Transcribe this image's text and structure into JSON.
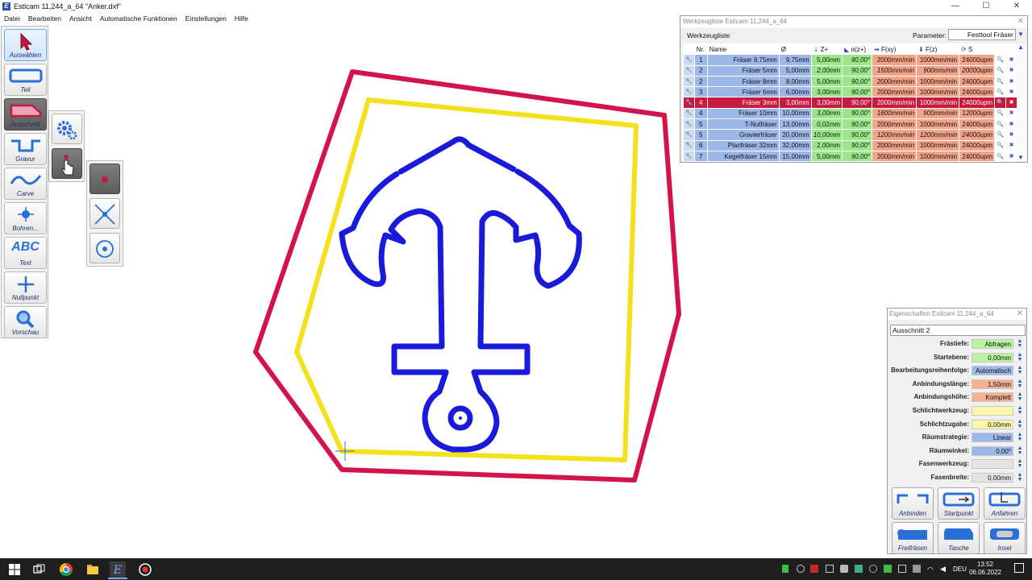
{
  "window": {
    "title": "Estlcam 11,244_a_64 \"Anker.dxf\"",
    "app_icon": "E",
    "minimize": "—",
    "maximize": "☐",
    "close": "✕"
  },
  "menu": [
    "Datei",
    "Bearbeiten",
    "Ansicht",
    "Automatische Funktionen",
    "Einstellungen",
    "Hilfe"
  ],
  "toolbar": [
    {
      "id": "auswahlen",
      "label": "Auswählen",
      "icon": "cursor-arrow-icon"
    },
    {
      "id": "teil",
      "label": "Teil",
      "icon": "part-outline-icon"
    },
    {
      "id": "ausschnitt",
      "label": "Ausschnitt",
      "icon": "cutout-icon"
    },
    {
      "id": "gravur",
      "label": "Gravur",
      "icon": "engrave-icon"
    },
    {
      "id": "carve",
      "label": "Carve",
      "icon": "carve-wave-icon"
    },
    {
      "id": "bohren",
      "label": "Bohren...",
      "icon": "drill-target-icon"
    },
    {
      "id": "text",
      "label": "Text",
      "glyph": "ABC",
      "icon": "text-abc-icon"
    },
    {
      "id": "nullpunkt",
      "label": "Nullpunkt",
      "icon": "zero-point-cross-icon"
    },
    {
      "id": "vorschau",
      "label": "Vorschau",
      "icon": "magnifier-icon"
    }
  ],
  "tool_window": {
    "title": "Werkzeugliste Estlcam 11,244_a_64",
    "close": "✕",
    "heading": "Werkzeugliste",
    "param_label": "Parameter:",
    "param_value": "Festtool Fräser",
    "columns": [
      "Nr.",
      "Name",
      "Ø",
      "Z+",
      "α(z+)",
      "F(xy)",
      "F(z)",
      "S"
    ],
    "rows": [
      {
        "nr": "1",
        "name": "Fräser 9,75mm",
        "d": "9,75mm",
        "z": "5,00mm",
        "az": "90,00°",
        "fxy": "2000mm/min",
        "fz": "1000mm/min",
        "s": "24000upm"
      },
      {
        "nr": "2",
        "name": "Fräser 5mm",
        "d": "5,00mm",
        "z": "2,00mm",
        "az": "90,00°",
        "fxy": "1500mm/min",
        "fz": "900mm/min",
        "s": "20000upm",
        "muted": true
      },
      {
        "nr": "2",
        "name": "Fräser 8mm",
        "d": "8,00mm",
        "z": "5,00mm",
        "az": "90,00°",
        "fxy": "2000mm/min",
        "fz": "1000mm/min",
        "s": "24000upm"
      },
      {
        "nr": "3",
        "name": "Fräser 6mm",
        "d": "6,00mm",
        "z": "3,00mm",
        "az": "90,00°",
        "fxy": "2000mm/min",
        "fz": "1000mm/min",
        "s": "24000upm"
      },
      {
        "nr": "4",
        "name": "Fräser 3mm",
        "d": "3,00mm",
        "z": "3,00mm",
        "az": "90,00°",
        "fxy": "2000mm/min",
        "fz": "1000mm/min",
        "s": "24000upm",
        "selected": true
      },
      {
        "nr": "4",
        "name": "Fräser 10mm",
        "d": "10,00mm",
        "z": "3,00mm",
        "az": "90,00°",
        "fxy": "1800mm/min",
        "fz": "900mm/min",
        "s": "12000upm",
        "muted": true
      },
      {
        "nr": "5",
        "name": "T-Nutfräser",
        "d": "13,00mm",
        "z": "0,02mm",
        "az": "90,00°",
        "fxy": "2000mm/min",
        "fz": "1000mm/min",
        "s": "24000upm"
      },
      {
        "nr": "5",
        "name": "Gravierfräser",
        "d": "20,00mm",
        "z": "10,00mm",
        "az": "90,00°",
        "fxy": "1200mm/min",
        "fz": "1200mm/min",
        "s": "24000upm",
        "muted": true
      },
      {
        "nr": "6",
        "name": "Planfräser 32mm",
        "d": "32,00mm",
        "z": "2,00mm",
        "az": "90,00°",
        "fxy": "2000mm/min",
        "fz": "1000mm/min",
        "s": "24000upm"
      },
      {
        "nr": "7",
        "name": "Kegelfräser 15mm",
        "d": "15,00mm",
        "z": "5,00mm",
        "az": "90,00°",
        "fxy": "2000mm/min",
        "fz": "1000mm/min",
        "s": "24000upm"
      }
    ]
  },
  "props_window": {
    "title": "Eigenschaften Estlcam 11,244_a_64",
    "close": "✕",
    "object_name": "Ausschnitt 2",
    "fields": [
      {
        "label": "Frästiefe:",
        "value": "Abfragen",
        "color": "#b9f59e"
      },
      {
        "label": "Startebene:",
        "value": "0,00mm",
        "color": "#b9f59e"
      },
      {
        "label": "Bearbeitungsreihenfolge:",
        "value": "Automatisch",
        "color": "#9db7e8"
      },
      {
        "label": "Anbindungslänge:",
        "value": "1,50mm",
        "color": "#f4b08f"
      },
      {
        "label": "Anbindungshöhe:",
        "value": "Komplett",
        "color": "#f4b08f"
      },
      {
        "label": "Schlichtwerkzeug:",
        "value": "",
        "color": "#fbf7a8"
      },
      {
        "label": "Schlichtzugabe:",
        "value": "0,00mm",
        "color": "#fbf7a8"
      },
      {
        "label": "Räumstrategie:",
        "value": "Linear",
        "color": "#9db7e8"
      },
      {
        "label": "Räumwinkel:",
        "value": "0,00°",
        "color": "#9db7e8"
      },
      {
        "label": "Fasenwerkzeug:",
        "value": "",
        "color": "#e4e4e4"
      },
      {
        "label": "Fasenbreite:",
        "value": "0,00mm",
        "color": "#e4e4e4"
      }
    ],
    "buttons": [
      {
        "label": "Anbinden",
        "icon": "bridge-icon"
      },
      {
        "label": "Startpunkt",
        "icon": "start-point-icon"
      },
      {
        "label": "Anfahren",
        "icon": "approach-icon"
      },
      {
        "label": "Freifräsen",
        "icon": "free-milling-icon"
      },
      {
        "label": "Tasche",
        "icon": "pocket-icon"
      },
      {
        "label": "Insel",
        "icon": "island-icon"
      }
    ]
  },
  "taskbar": {
    "time": "13:52",
    "date": "06.06.2022",
    "lang": "DEU"
  },
  "colors": {
    "outer_path": "#d2144a",
    "inner_path": "#f2e11b",
    "anchor": "#1a1adb",
    "selected_row": "#c8193f"
  }
}
